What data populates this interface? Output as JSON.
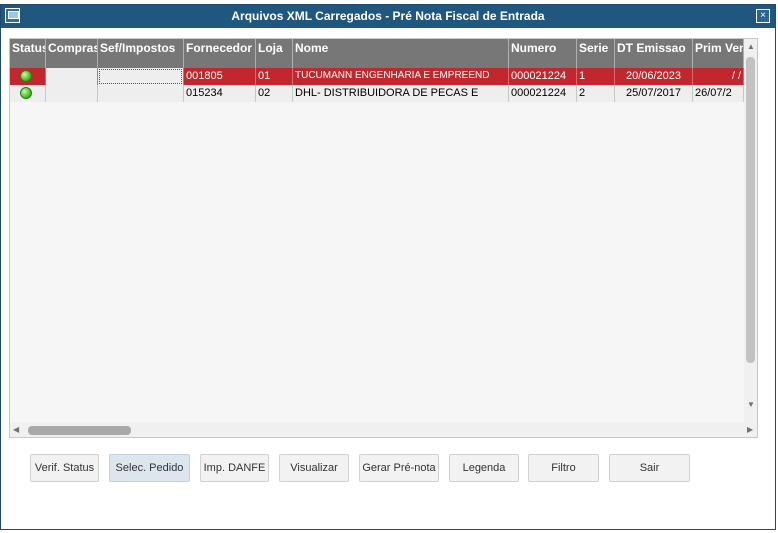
{
  "window": {
    "title": "Arquivos XML Carregados - Pré Nota Fiscal de Entrada",
    "close_glyph": "×"
  },
  "grid": {
    "columns": [
      "Status",
      "Compras",
      "Sef/Impostos",
      "Fornecedor",
      "Loja",
      "Nome",
      "Numero",
      "Serie",
      "DT Emissao",
      "Prim Ven"
    ],
    "rows": [
      {
        "status": "green-dot-icon",
        "compras": "",
        "sef": "",
        "fornecedor": "001805",
        "loja": "01",
        "nome": "TUCUMANN ENGENHARIA E EMPREEND",
        "numero": "000021224",
        "serie": "1",
        "dt": "20/06/2023",
        "prim": "/ /"
      },
      {
        "status": "green-dot-icon",
        "compras": "",
        "sef": "",
        "fornecedor": "015234",
        "loja": "02",
        "nome": "DHL- DISTRIBUIDORA DE PECAS E",
        "numero": "000021224",
        "serie": "2",
        "dt": "25/07/2017",
        "prim": "26/07/2"
      }
    ],
    "scroll_up": "▲",
    "scroll_down": "▼",
    "scroll_left": "◀",
    "scroll_right": "▶"
  },
  "buttons": {
    "verif_status": "Verif. Status",
    "selec_pedido": "Selec. Pedido",
    "imp_danfe": "Imp. DANFE",
    "visualizar": "Visualizar",
    "gerar_pre_nota": "Gerar Pré-nota",
    "legenda": "Legenda",
    "filtro": "Filtro",
    "sair": "Sair"
  },
  "colors": {
    "titlebar": "#20577f",
    "selected_row": "#c1272d",
    "header": "#777777",
    "status_ok": "#3ab01a"
  }
}
